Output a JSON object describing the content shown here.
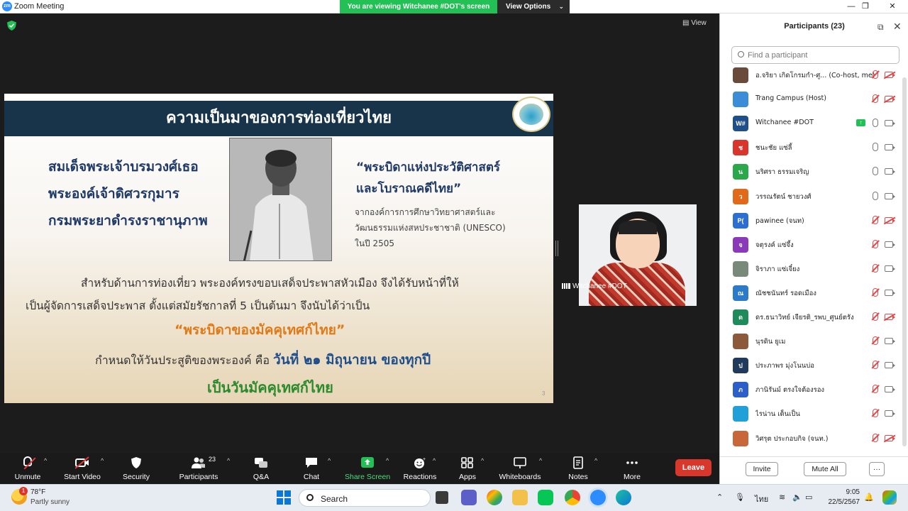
{
  "window": {
    "title": "Zoom Meeting",
    "viewing_banner": "You are viewing Witchanee #DOT's screen",
    "view_options": "View Options",
    "minimize": "—",
    "restore": "❐",
    "close": "✕"
  },
  "stage": {
    "view_label": "View",
    "video_tile_name": "Witchanee #DOT"
  },
  "slide": {
    "title": "ความเป็นมาของการท่องเที่ยวไทย",
    "name_lines": [
      "สมเด็จพระเจ้าบรมวงศ์เธอ",
      "พระองค์เจ้าดิศวรกุมาร",
      "กรมพระยาดำรงราชานุภาพ"
    ],
    "quote_lines": [
      "“พระบิดาแห่งประวัติศาสตร์",
      "และโบราณคดีไทย”"
    ],
    "source_lines": [
      "จากองค์การการศึกษาวิทยาศาสตร์และ",
      "วัฒนธรรมแห่งสหประชาชาติ (UNESCO)",
      "ในปี 2505"
    ],
    "body_lines": [
      "สำหรับด้านการท่องเที่ยว พระองค์ทรงขอบเสด็จประพาสหัวเมือง จึงได้รับหน้าที่ให้",
      "เป็นผู้จัดการเสด็จประพาส ตั้งแต่สมัยรัชกาลที่ 5 เป็นต้นมา จึงนับได้ว่าเป็น"
    ],
    "highlight": "“พระบิดาของมัคคุเทศก์ไทย”",
    "date_prefix": "กำหนดให้วันประสูติของพระองค์ คือ ",
    "date_value": "วันที่ ๒๑ มิถุนายน ของทุกปี",
    "final_line": "เป็นวันมัคคุเทศก์ไทย",
    "page_number": "3"
  },
  "toolbar": {
    "items": [
      {
        "label": "Unmute",
        "icon": "mic-muted-icon"
      },
      {
        "label": "Start Video",
        "icon": "video-off-icon"
      },
      {
        "label": "Security",
        "icon": "shield-icon"
      },
      {
        "label": "Participants",
        "icon": "participants-icon",
        "badge": "23"
      },
      {
        "label": "Q&A",
        "icon": "qa-icon"
      },
      {
        "label": "Chat",
        "icon": "chat-icon"
      },
      {
        "label": "Share Screen",
        "icon": "share-screen-icon"
      },
      {
        "label": "Reactions",
        "icon": "reactions-icon"
      },
      {
        "label": "Apps",
        "icon": "apps-icon"
      },
      {
        "label": "Whiteboards",
        "icon": "whiteboard-icon"
      },
      {
        "label": "Notes",
        "icon": "notes-icon"
      },
      {
        "label": "More",
        "icon": "more-icon"
      }
    ],
    "leave": "Leave",
    "caret": "^"
  },
  "panel": {
    "title": "Participants (23)",
    "search_placeholder": "Find a participant",
    "participants": [
      {
        "name": "อ.จริยา เกิดโกรมกำ-ศู... (Co-host, me)",
        "initials": "",
        "color": "#6a4a3a",
        "mic": "off",
        "cam": "off",
        "sharing": false
      },
      {
        "name": "Trang Campus (Host)",
        "initials": "",
        "color": "#3a8ed8",
        "mic": "off",
        "cam": "off",
        "sharing": false
      },
      {
        "name": "Witchanee #DOT",
        "initials": "W#",
        "color": "#1f4f8a",
        "mic": "on",
        "cam": "on",
        "sharing": true
      },
      {
        "name": "ชนะชัย แซ่ลี้",
        "initials": "ช",
        "color": "#d9362b",
        "mic": "on",
        "cam": "on",
        "sharing": false
      },
      {
        "name": "นริศรา ธรรมเจริญ",
        "initials": "น",
        "color": "#2aa84a",
        "mic": "on",
        "cam": "on",
        "sharing": false
      },
      {
        "name": "วรรณรัตน์ ชายวงศ์",
        "initials": "ว",
        "color": "#e06a1a",
        "mic": "on",
        "cam": "on",
        "sharing": false
      },
      {
        "name": "pawinee (จนท)",
        "initials": "P(",
        "color": "#2d6fd0",
        "mic": "off",
        "cam": "off",
        "sharing": false
      },
      {
        "name": "จตุรงค์ แซ่จึ้ง",
        "initials": "จ",
        "color": "#8a3ab8",
        "mic": "off",
        "cam": "on",
        "sharing": false
      },
      {
        "name": "จิราภา แซ่เจี๋ยง",
        "initials": "",
        "color": "#7a8a7a",
        "mic": "off",
        "cam": "on",
        "sharing": false
      },
      {
        "name": "ณัชชนันทร์ รอดเมือง",
        "initials": "ณ",
        "color": "#2d7ac8",
        "mic": "off",
        "cam": "on",
        "sharing": false
      },
      {
        "name": "ดร.ธนาวิทย์ เจียรติ_รพบ_ศูนย์ตรัง",
        "initials": "ด",
        "color": "#1f8a5a",
        "mic": "off",
        "cam": "off",
        "sharing": false
      },
      {
        "name": "นุรดิน ยูเม",
        "initials": "",
        "color": "#8a5a3a",
        "mic": "off",
        "cam": "on",
        "sharing": false
      },
      {
        "name": "ประภาพร มุ่งโนนบ่อ",
        "initials": "ป",
        "color": "#1f3a5a",
        "mic": "off",
        "cam": "on",
        "sharing": false
      },
      {
        "name": "ภานิรันม์ ตรงใจต้องรอง",
        "initials": "ภ",
        "color": "#2d5fc8",
        "mic": "off",
        "cam": "on",
        "sharing": false
      },
      {
        "name": "ไรน่าน เต็นเป็น",
        "initials": "",
        "color": "#1fa0d8",
        "mic": "off",
        "cam": "on",
        "sharing": false
      },
      {
        "name": "วิศรุต ประกอบกิจ (จนท.)",
        "initials": "",
        "color": "#c8683a",
        "mic": "off",
        "cam": "off",
        "sharing": false
      }
    ],
    "invite": "Invite",
    "mute_all": "Mute All",
    "more": "···"
  },
  "taskbar": {
    "weather_badge": "1",
    "weather_temp": "78°F",
    "weather_desc": "Partly sunny",
    "search_label": "Search",
    "lang": "ไทย",
    "time": "9:05",
    "date": "22/5/2567"
  },
  "colors": {
    "accent_green": "#23c055",
    "slide_header": "#17344b",
    "leave_red": "#d8382c"
  }
}
